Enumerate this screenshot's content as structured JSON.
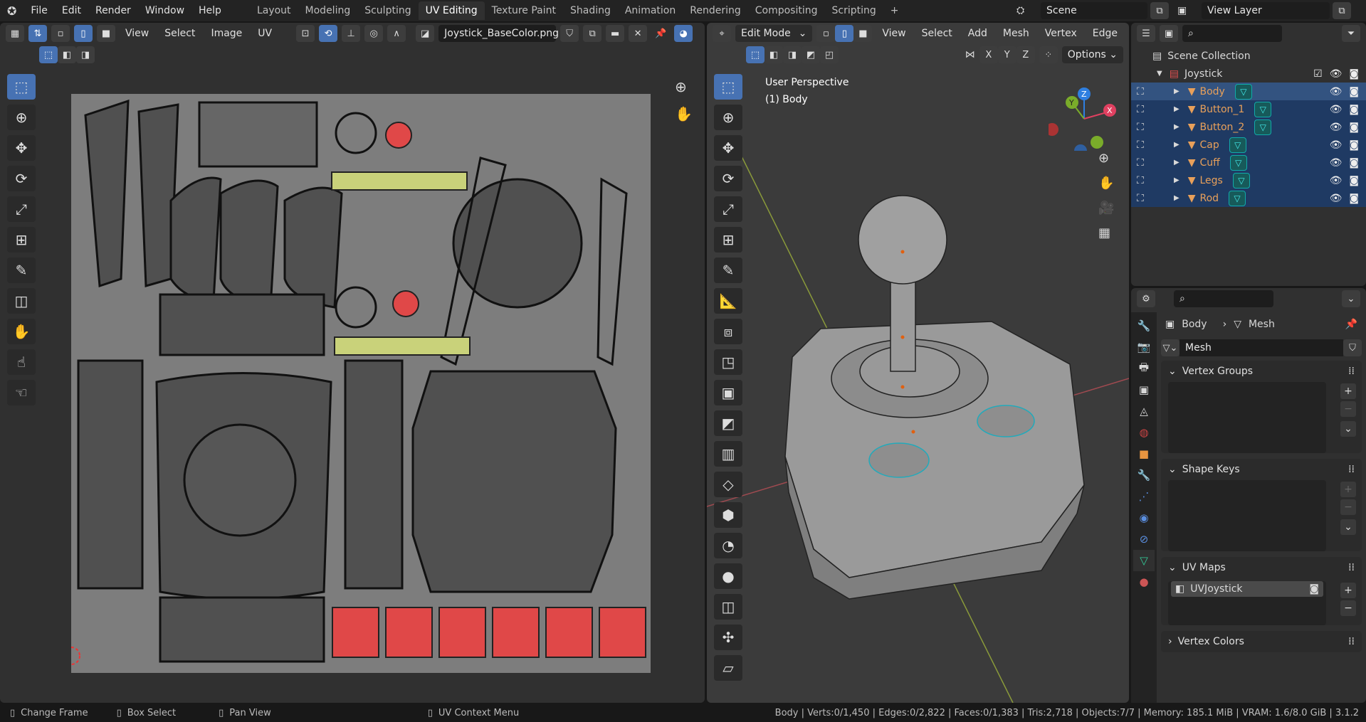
{
  "topbar": {
    "menus": [
      "File",
      "Edit",
      "Render",
      "Window",
      "Help"
    ],
    "workspaces": [
      "Layout",
      "Modeling",
      "Sculpting",
      "UV Editing",
      "Texture Paint",
      "Shading",
      "Animation",
      "Rendering",
      "Compositing",
      "Scripting"
    ],
    "active_workspace": "UV Editing",
    "add": "+",
    "scene": "Scene",
    "view_layer": "View Layer"
  },
  "uv_editor": {
    "menus": [
      "View",
      "Select",
      "Image",
      "UV"
    ],
    "image_name": "Joystick_BaseColor.png"
  },
  "viewport": {
    "mode": "Edit Mode",
    "menus": [
      "View",
      "Select",
      "Add",
      "Mesh",
      "Vertex",
      "Edge"
    ],
    "axes": [
      "X",
      "Y",
      "Z"
    ],
    "options": "Options",
    "overlay_title": "User Perspective",
    "overlay_object": "(1) Body",
    "gizmo": {
      "x": "X",
      "y": "Y",
      "z": "Z"
    }
  },
  "outliner": {
    "root": "Scene Collection",
    "collection": "Joystick",
    "objects": [
      "Body",
      "Button_1",
      "Button_2",
      "Cap",
      "Cuff",
      "Legs",
      "Rod"
    ],
    "active": "Body"
  },
  "properties": {
    "breadcrumb": {
      "object": "Body",
      "data": "Mesh"
    },
    "mesh_name": "Mesh",
    "panels": {
      "vertex_groups": "Vertex Groups",
      "shape_keys": "Shape Keys",
      "uv_maps": "UV Maps",
      "vertex_colors": "Vertex Colors"
    },
    "uv_map_item": "UVJoystick"
  },
  "status": {
    "hints": [
      "Change Frame",
      "Box Select",
      "Pan View",
      "UV Context Menu"
    ],
    "stats": "Body | Verts:0/1,450 | Edges:0/2,822 | Faces:0/1,383 | Tris:2,718 | Objects:7/7 | Memory: 185.1 MiB | VRAM: 1.6/8.0 GiB | 3.1.2"
  },
  "colors": {
    "accent": "#4772b3",
    "selection": "#1f3a63",
    "object_name": "#e8a05a",
    "mesh_icon": "#44dddd"
  }
}
